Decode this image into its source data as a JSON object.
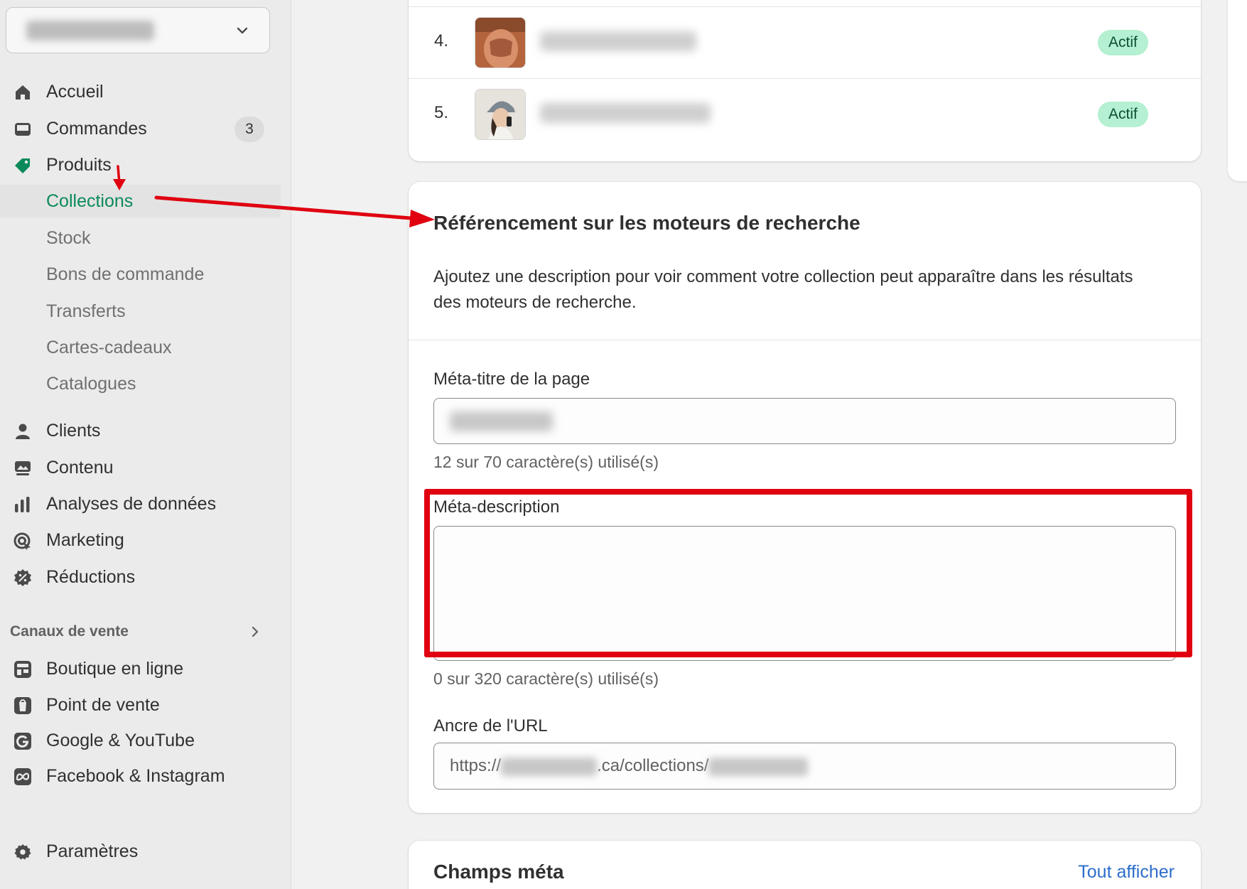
{
  "sidebar": {
    "items": [
      {
        "label": "Accueil",
        "icon": "home-icon"
      },
      {
        "label": "Commandes",
        "icon": "inbox-icon",
        "badge": "3"
      },
      {
        "label": "Produits",
        "icon": "tag-icon"
      },
      {
        "label": "Collections"
      },
      {
        "label": "Stock"
      },
      {
        "label": "Bons de commande"
      },
      {
        "label": "Transferts"
      },
      {
        "label": "Cartes-cadeaux"
      },
      {
        "label": "Catalogues"
      },
      {
        "label": "Clients",
        "icon": "person-icon"
      },
      {
        "label": "Contenu",
        "icon": "content-icon"
      },
      {
        "label": "Analyses de données",
        "icon": "bar-chart-icon"
      },
      {
        "label": "Marketing",
        "icon": "target-icon"
      },
      {
        "label": "Réductions",
        "icon": "discount-icon"
      }
    ],
    "sales_channels_heading": "Canaux de vente",
    "channels": [
      {
        "label": "Boutique en ligne",
        "icon": "storefront-icon"
      },
      {
        "label": "Point de vente",
        "icon": "pos-icon"
      },
      {
        "label": "Google & YouTube",
        "icon": "google-icon"
      },
      {
        "label": "Facebook & Instagram",
        "icon": "meta-icon"
      }
    ],
    "settings_label": "Paramètres"
  },
  "products": {
    "rows": [
      {
        "num": "4.",
        "status": "Actif"
      },
      {
        "num": "5.",
        "status": "Actif"
      }
    ]
  },
  "seo": {
    "title": "Référencement sur les moteurs de recherche",
    "description": "Ajoutez une description pour voir comment votre collection peut apparaître dans les résultats des moteurs de recherche.",
    "meta_title_label": "Méta-titre de la page",
    "meta_title_help": "12 sur 70 caractère(s) utilisé(s)",
    "meta_description_label": "Méta-description",
    "meta_description_value": "",
    "meta_description_help": "0 sur 320 caractère(s) utilisé(s)",
    "url_label": "Ancre de l'URL",
    "url_prefix": "https://",
    "url_middle": ".ca/collections/"
  },
  "metafields": {
    "title": "Champs méta",
    "view_all": "Tout afficher"
  },
  "colors": {
    "accent_green": "#0a8a5a",
    "status_bg": "#b4f0d1",
    "link_blue": "#2c6ecb",
    "annotation_red": "#e00010"
  }
}
